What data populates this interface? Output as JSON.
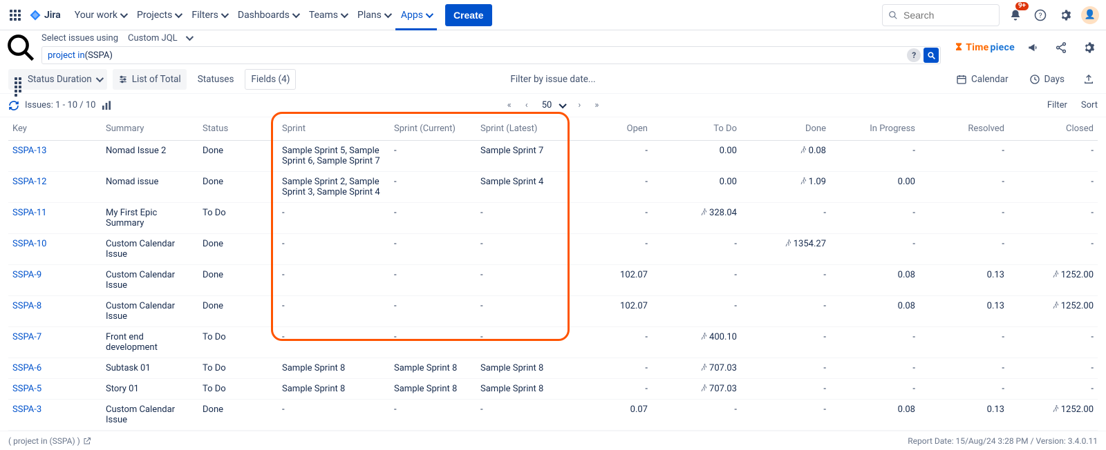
{
  "nav": {
    "jira": "Jira",
    "items": [
      "Your work",
      "Projects",
      "Filters",
      "Dashboards",
      "Teams",
      "Plans",
      "Apps"
    ],
    "create": "Create",
    "search_placeholder": "Search",
    "notif_badge": "9+"
  },
  "subheader": {
    "label": "Select issues using",
    "mode": "Custom JQL",
    "jql_keyword": "project in",
    "jql_rest": " (SSPA)",
    "brand_time": "Time",
    "brand_piece": "piece"
  },
  "toolbar": {
    "status_duration": "Status Duration",
    "list_of_total": "List of Total",
    "statuses": "Statuses",
    "fields": "Fields (4)",
    "center": "Filter by issue date...",
    "calendar": "Calendar",
    "days": "Days"
  },
  "pager": {
    "issues_label": "Issues: 1 - 10 / 10",
    "page_size": "50",
    "filter": "Filter",
    "sort": "Sort"
  },
  "columns": {
    "key": "Key",
    "summary": "Summary",
    "status": "Status",
    "sprint": "Sprint",
    "sprint_current": "Sprint (Current)",
    "sprint_latest": "Sprint (Latest)",
    "open": "Open",
    "todo": "To Do",
    "done": "Done",
    "inprogress": "In Progress",
    "resolved": "Resolved",
    "closed": "Closed"
  },
  "rows": [
    {
      "key": "SSPA-13",
      "summary": "Nomad Issue 2",
      "status": "Done",
      "sprint": "Sample Sprint 5, Sample Sprint 6, Sample Sprint 7",
      "scur": "-",
      "slat": "Sample Sprint 7",
      "open": "-",
      "todo": "0.00",
      "todo_icon": false,
      "done": "0.08",
      "done_icon": true,
      "inprog": "-",
      "resolved": "-",
      "closed": "-",
      "closed_icon": false
    },
    {
      "key": "SSPA-12",
      "summary": "Nomad issue",
      "status": "Done",
      "sprint": "Sample Sprint 2, Sample Sprint 3, Sample Sprint 4",
      "scur": "-",
      "slat": "Sample Sprint 4",
      "open": "-",
      "todo": "0.00",
      "todo_icon": false,
      "done": "1.09",
      "done_icon": true,
      "inprog": "0.00",
      "resolved": "-",
      "closed": "-",
      "closed_icon": false
    },
    {
      "key": "SSPA-11",
      "summary": "My First Epic Summary",
      "status": "To Do",
      "sprint": "-",
      "scur": "-",
      "slat": "-",
      "open": "-",
      "todo": "328.04",
      "todo_icon": true,
      "done": "-",
      "done_icon": false,
      "inprog": "-",
      "resolved": "-",
      "closed": "-",
      "closed_icon": false
    },
    {
      "key": "SSPA-10",
      "summary": "Custom Calendar Issue",
      "status": "Done",
      "sprint": "-",
      "scur": "-",
      "slat": "-",
      "open": "-",
      "todo": "-",
      "todo_icon": false,
      "done": "1354.27",
      "done_icon": true,
      "inprog": "-",
      "resolved": "-",
      "closed": "-",
      "closed_icon": false
    },
    {
      "key": "SSPA-9",
      "summary": "Custom Calendar Issue",
      "status": "Done",
      "sprint": "-",
      "scur": "-",
      "slat": "-",
      "open": "102.07",
      "todo": "-",
      "todo_icon": false,
      "done": "-",
      "done_icon": false,
      "inprog": "0.08",
      "resolved": "0.13",
      "closed": "1252.00",
      "closed_icon": true
    },
    {
      "key": "SSPA-8",
      "summary": "Custom Calendar Issue",
      "status": "Done",
      "sprint": "-",
      "scur": "-",
      "slat": "-",
      "open": "102.07",
      "todo": "-",
      "todo_icon": false,
      "done": "-",
      "done_icon": false,
      "inprog": "0.08",
      "resolved": "0.13",
      "closed": "1252.00",
      "closed_icon": true
    },
    {
      "key": "SSPA-7",
      "summary": "Front end development",
      "status": "To Do",
      "sprint": "-",
      "scur": "-",
      "slat": "-",
      "open": "-",
      "todo": "400.10",
      "todo_icon": true,
      "done": "-",
      "done_icon": false,
      "inprog": "-",
      "resolved": "-",
      "closed": "-",
      "closed_icon": false
    },
    {
      "key": "SSPA-6",
      "summary": "Subtask 01",
      "status": "To Do",
      "sprint": "Sample Sprint 8",
      "scur": "Sample Sprint 8",
      "slat": "Sample Sprint 8",
      "open": "-",
      "todo": "707.03",
      "todo_icon": true,
      "done": "-",
      "done_icon": false,
      "inprog": "-",
      "resolved": "-",
      "closed": "-",
      "closed_icon": false
    },
    {
      "key": "SSPA-5",
      "summary": "Story 01",
      "status": "To Do",
      "sprint": "Sample Sprint 8",
      "scur": "Sample Sprint 8",
      "slat": "Sample Sprint 8",
      "open": "-",
      "todo": "707.03",
      "todo_icon": true,
      "done": "-",
      "done_icon": false,
      "inprog": "-",
      "resolved": "-",
      "closed": "-",
      "closed_icon": false
    },
    {
      "key": "SSPA-3",
      "summary": "Custom Calendar Issue",
      "status": "Done",
      "sprint": "-",
      "scur": "-",
      "slat": "-",
      "open": "0.07",
      "todo": "-",
      "todo_icon": false,
      "done": "-",
      "done_icon": false,
      "inprog": "0.08",
      "resolved": "0.13",
      "closed": "1252.00",
      "closed_icon": true
    }
  ],
  "footer": {
    "jql": "( project in (SSPA) )",
    "report": "Report Date: 15/Aug/24 3:28 PM / Version: 3.4.0.11"
  }
}
